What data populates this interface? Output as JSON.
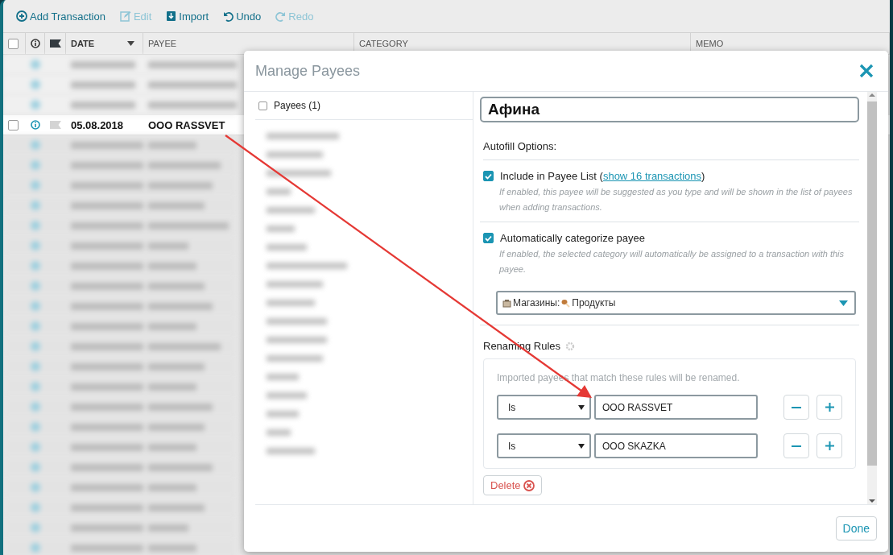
{
  "toolbar": [
    {
      "kind": "add",
      "label": "Add Transaction",
      "disabled": false
    },
    {
      "kind": "edit",
      "label": "Edit",
      "disabled": true
    },
    {
      "kind": "import",
      "label": "Import",
      "disabled": false
    },
    {
      "kind": "undo",
      "label": "Undo",
      "disabled": false
    },
    {
      "kind": "redo",
      "label": "Redo",
      "disabled": true
    }
  ],
  "table": {
    "select_all_checked": false,
    "columns": [
      {
        "label": "DATE",
        "sorted": true
      },
      {
        "label": "PAYEE",
        "sorted": false
      },
      {
        "label": "CATEGORY",
        "sorted": false
      },
      {
        "label": "MEMO",
        "sorted": false
      }
    ],
    "rows": [
      {
        "date": "05.08.2018",
        "payee": "OOO RASSVET",
        "checked": false
      }
    ]
  },
  "dialog": {
    "title": "Manage Payees",
    "payee_list": {
      "label": "Payees (1)",
      "checked": false
    },
    "name_value": "Афина",
    "autofill_heading": "Autofill Options:",
    "options": [
      {
        "label": "Include in Payee List (",
        "link": "show 16 transactions",
        "label_end": ")",
        "description": "If enabled, this payee will be suggested as you type and will be shown in the list of payees when adding transactions.",
        "checked": true
      },
      {
        "label": "Automatically categorize payee",
        "description": "If enabled, the selected category will automatically be assigned to a transaction with this payee.",
        "checked": true
      }
    ],
    "category": {
      "group": "Магазины:",
      "name": "Продукты"
    },
    "renaming": {
      "heading": "Renaming Rules",
      "description": "Imported payees that match these rules will be renamed.",
      "rules": [
        {
          "operator": "Is",
          "value": "OOO RASSVET"
        },
        {
          "operator": "Is",
          "value": "OOO SKAZKA"
        }
      ]
    },
    "delete_label": "Delete",
    "done_label": "Done"
  }
}
